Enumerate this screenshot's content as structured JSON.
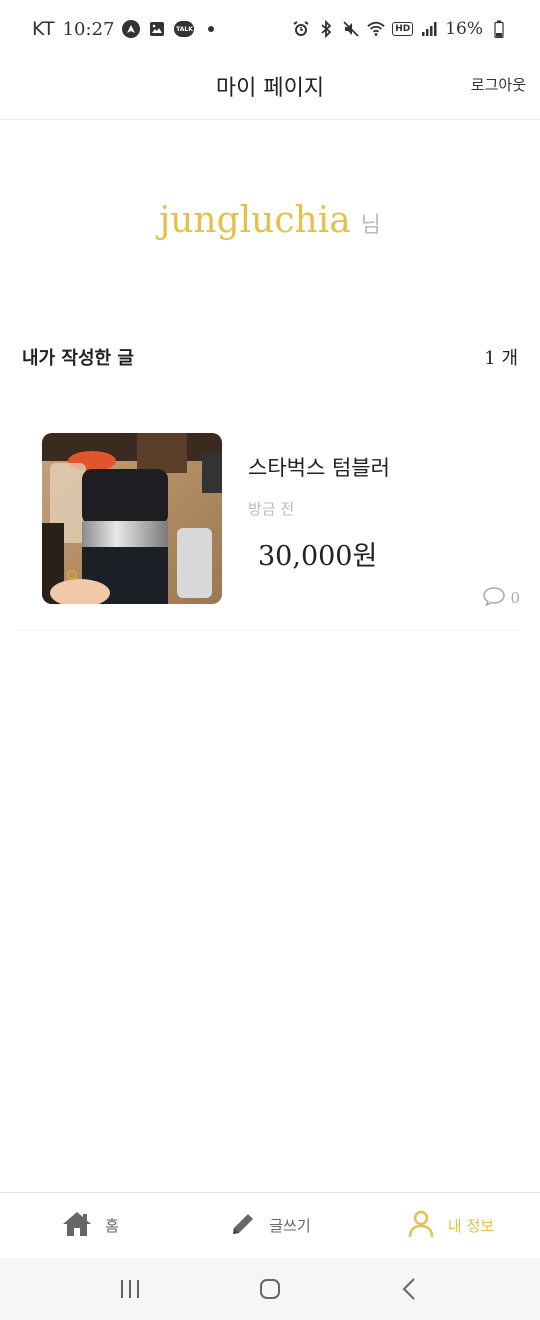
{
  "status_bar": {
    "carrier": "KT",
    "time": "10:27",
    "talk_icon_text": "TALK",
    "hd_label": "HD",
    "battery": "16%"
  },
  "header": {
    "title": "마이 페이지",
    "logout_label": "로그아웃"
  },
  "profile": {
    "username": "jungluchia",
    "honorific": "님"
  },
  "posts": {
    "section_title": "내가 작성한 글",
    "count": "1 개",
    "items": [
      {
        "title": "스타벅스 텀블러",
        "time": "방금 전",
        "price": "30,000원",
        "comments": "0",
        "image": "tumbler-photo"
      }
    ]
  },
  "bottom_nav": {
    "items": [
      {
        "label": "홈",
        "icon": "home-icon",
        "active": false
      },
      {
        "label": "글쓰기",
        "icon": "pencil-icon",
        "active": false
      },
      {
        "label": "내 정보",
        "icon": "person-icon",
        "active": true
      }
    ]
  },
  "colors": {
    "accent": "#e5c04a",
    "muted": "#bbbbbb",
    "text": "#222222"
  }
}
